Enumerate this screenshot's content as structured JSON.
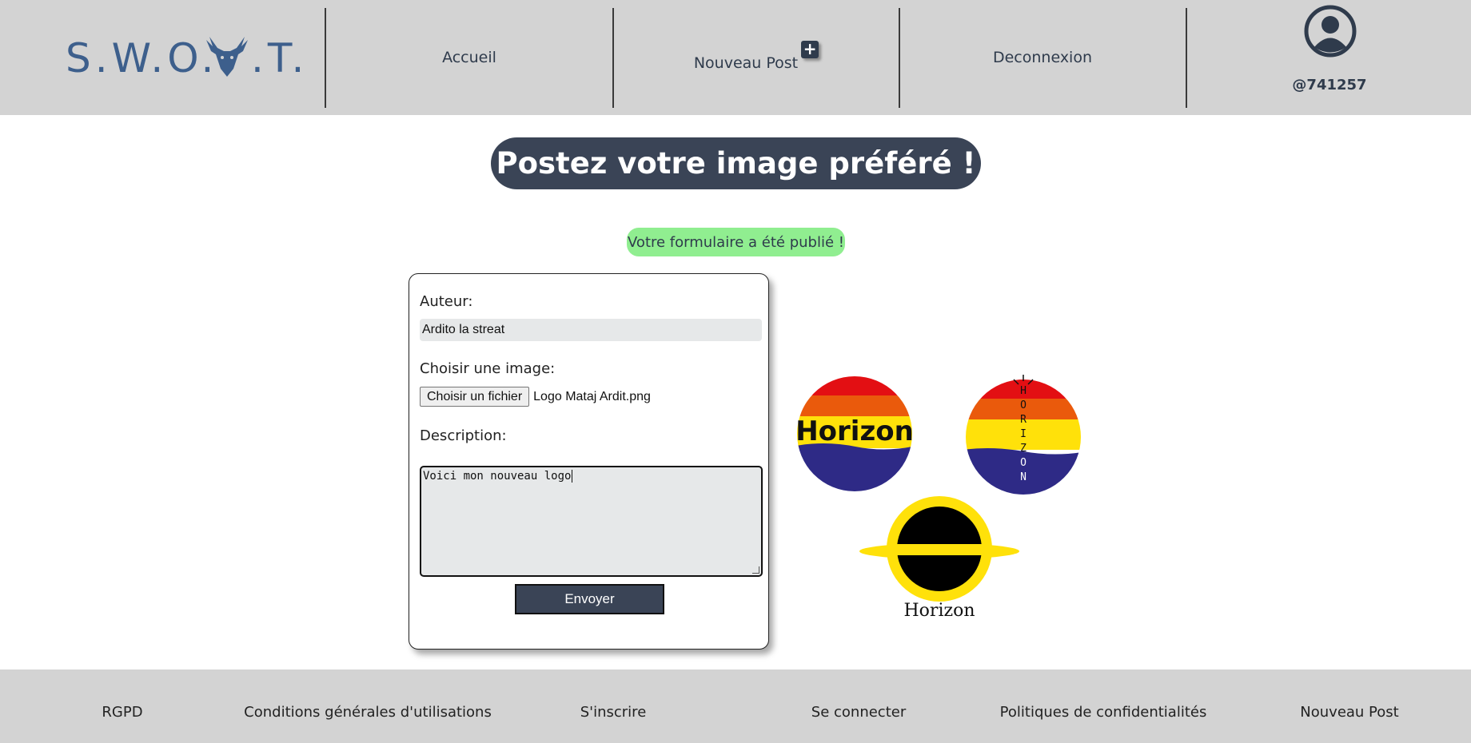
{
  "header": {
    "logo_text": "S.W.O.T.",
    "nav": {
      "accueil": "Accueil",
      "nouveau_post": "Nouveau Post",
      "deconnexion": "Deconnexion"
    },
    "profile": {
      "handle": "@741257"
    }
  },
  "main": {
    "title": "Postez votre image préféré !",
    "success_message": "Votre formulaire a été publié !",
    "form": {
      "author_label": "Auteur:",
      "author_value": "Ardito la streat",
      "image_label": "Choisir une image:",
      "file_button": "Choisir un fichier",
      "file_name": "Logo Mataj Ardit.png",
      "description_label": "Description:",
      "description_value": "Voici mon nouveau logo",
      "submit": "Envoyer"
    },
    "preview": {
      "logo1_text": "Horizon",
      "logo2_letters": "HORIZON",
      "logo3_text": "Horizon"
    }
  },
  "footer": {
    "links": [
      "RGPD",
      "Conditions générales d'utilisations",
      "S'inscrire",
      "Se connecter",
      "Politiques de confidentialités",
      "Nouveau Post"
    ]
  },
  "colors": {
    "header_bg": "#d3d3d3",
    "primary_dark": "#3a4456",
    "logo_blue": "#3d5f8c",
    "success_green": "#90ee90"
  },
  "icons": {
    "plus": "plus-square-icon",
    "avatar": "user-circle-icon",
    "logo_mark": "deer-head-icon"
  }
}
